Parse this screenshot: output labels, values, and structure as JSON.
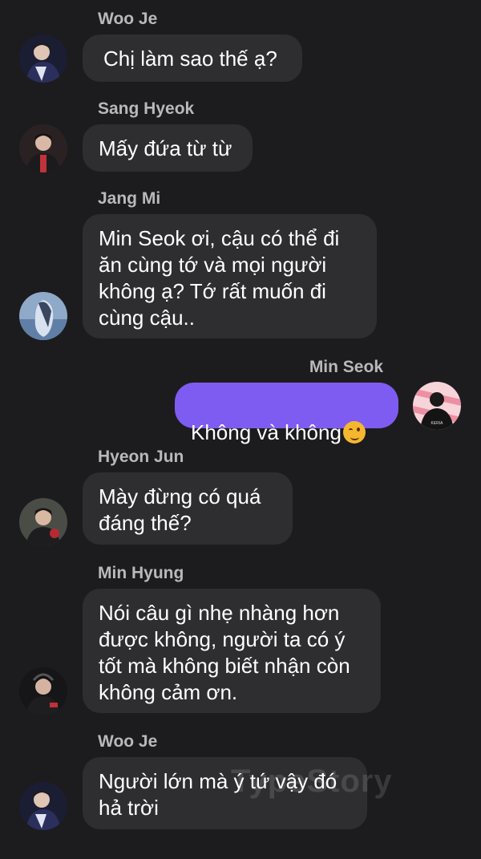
{
  "messages": [
    {
      "sender": "Woo Je",
      "text": "Chị làm sao thế ạ?",
      "avatar": "player-photo-avatar"
    },
    {
      "sender": "Sang Hyeok",
      "text": "Mấy đứa từ từ",
      "avatar": "player-photo-avatar"
    },
    {
      "sender": "Jang Mi",
      "text": "Min Seok ơi, cậu có thể đi ăn cùng tớ và mọi người không ạ? Tớ rất muốn đi cùng cậu..",
      "avatar": "girl-photo-avatar"
    },
    {
      "sender": "Min Seok",
      "text": "Không và không",
      "emoji": "winking-face-icon",
      "avatar": "player-silhouette-avatar",
      "outgoing": true
    },
    {
      "sender": "Hyeon Jun",
      "text": "Mày đừng có quá đáng thế?",
      "avatar": "player-photo-avatar"
    },
    {
      "sender": "Min Hyung",
      "text": "Nói câu gì nhẹ nhàng hơn được không, người ta có ý tốt mà không biết nhận còn không cảm ơn.",
      "avatar": "player-photo-avatar"
    },
    {
      "sender": "Woo Je",
      "text": "Người lớn mà ý tứ vậy đó hả trời",
      "avatar": "player-photo-avatar"
    }
  ],
  "avatar_label": "KERIA",
  "watermark": "TypeStory",
  "colors": {
    "background": "#1c1c1e",
    "incoming_bubble": "#2e2e31",
    "outgoing_bubble": "#7e5cf2",
    "sender_name": "#b9b9bd",
    "text": "#ffffff"
  }
}
